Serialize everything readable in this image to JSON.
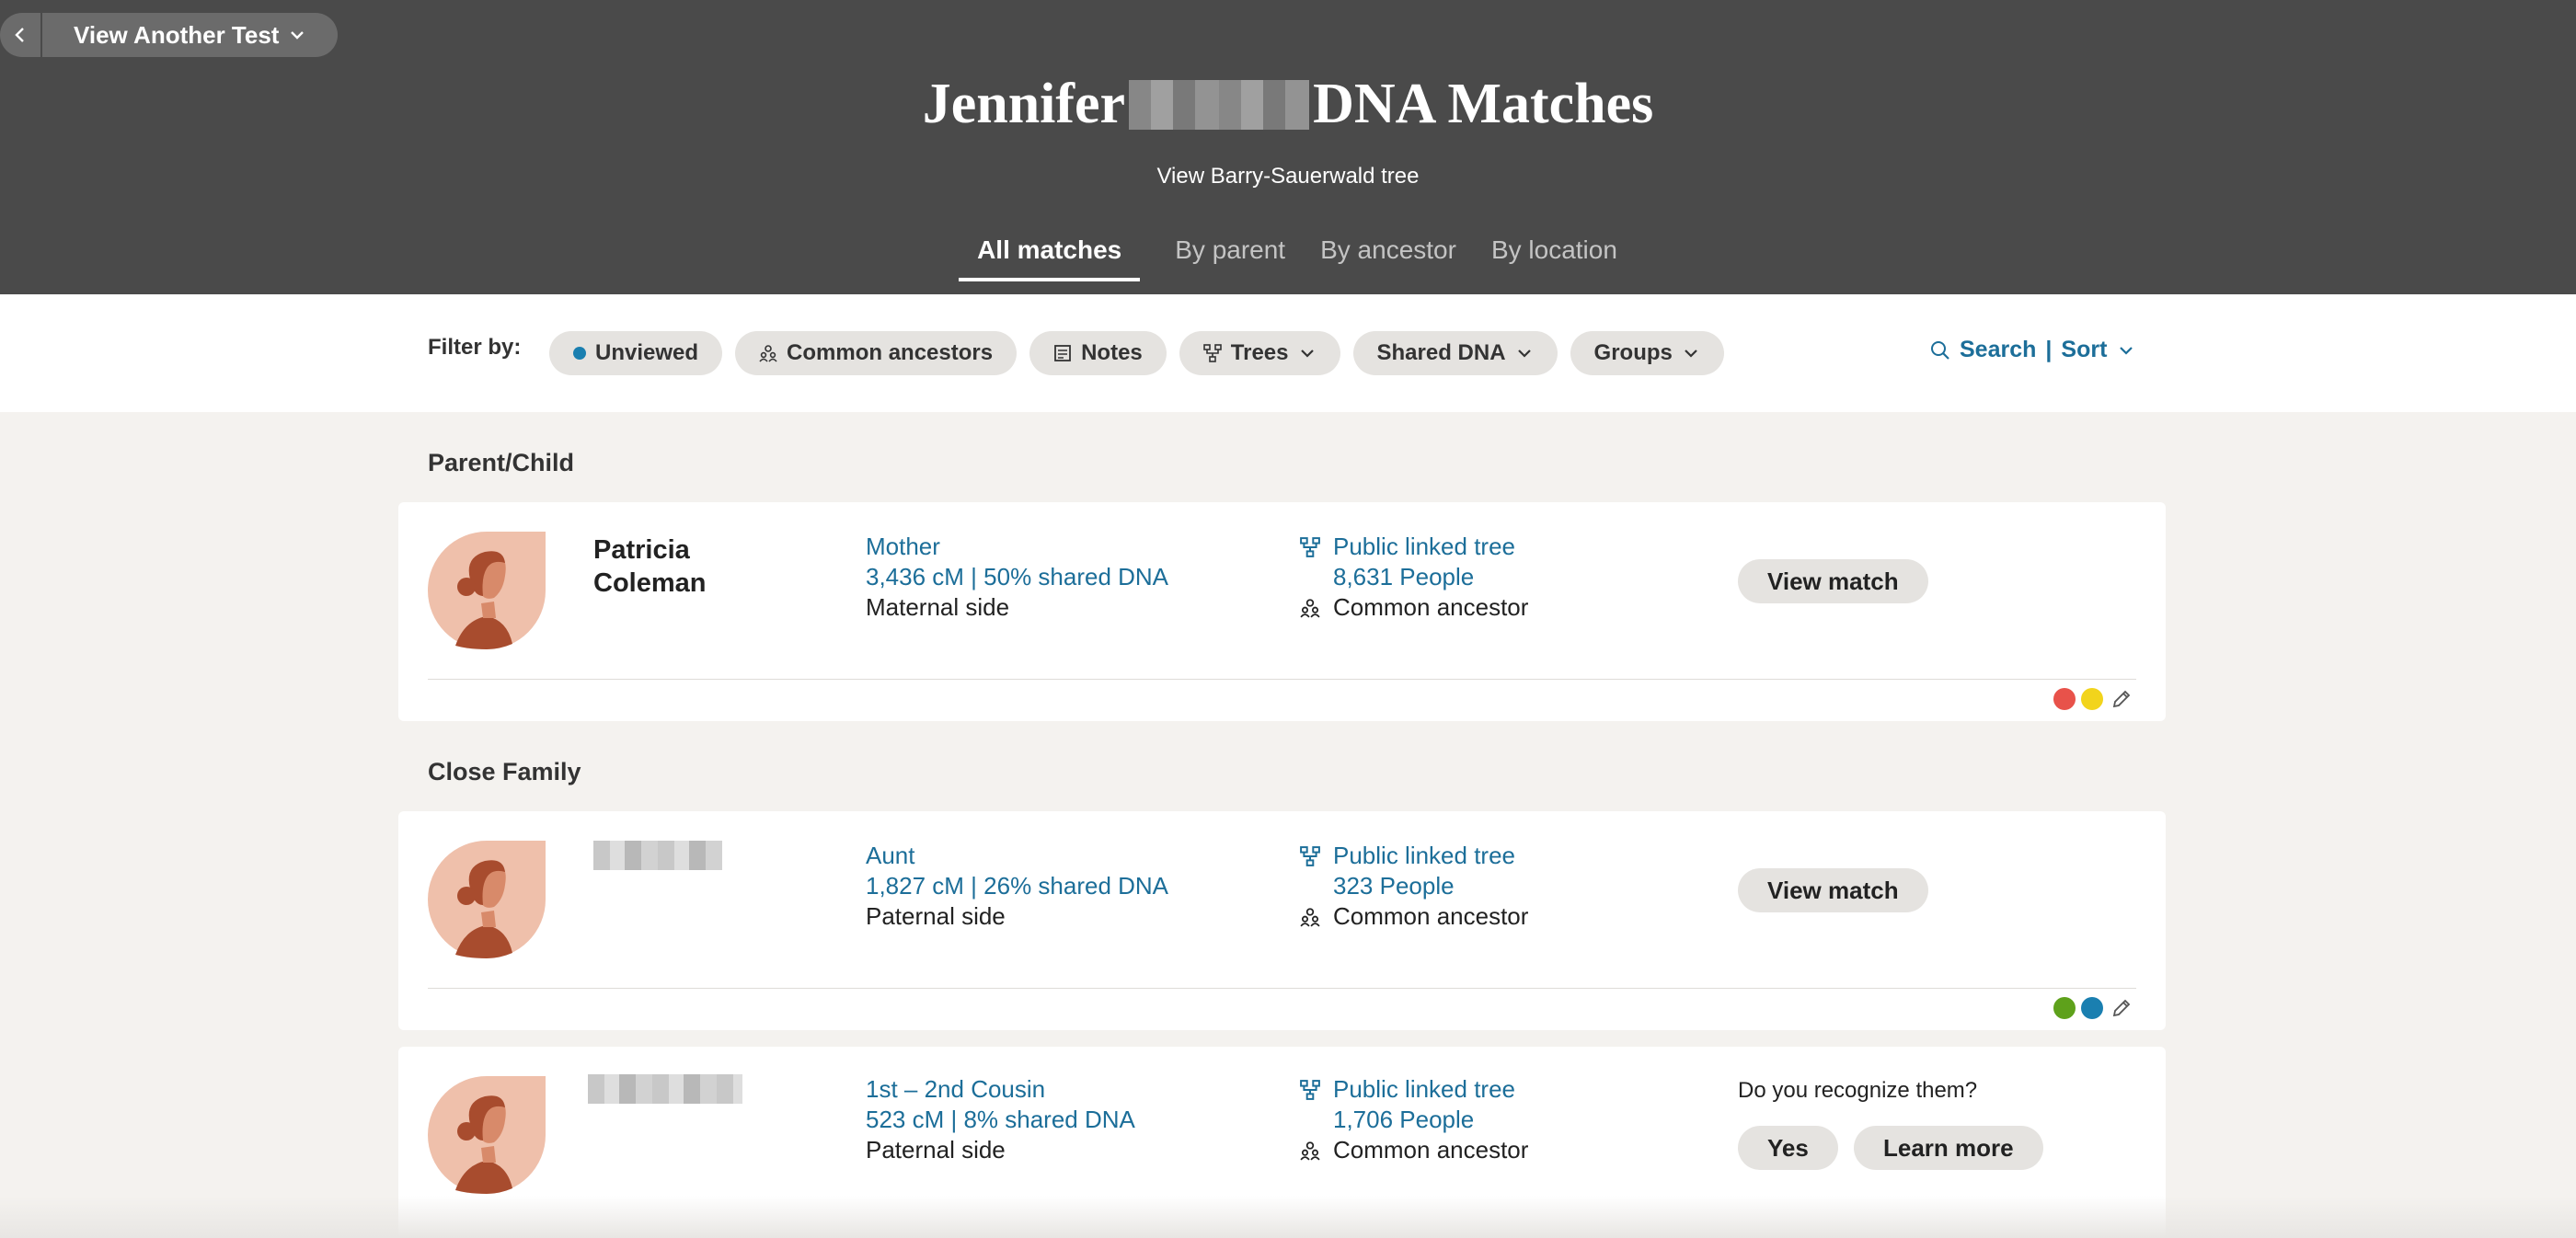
{
  "header": {
    "view_another_test": "View Another Test",
    "title_first": "Jennifer",
    "title_last": "DNA Matches",
    "tree_link": "View Barry-Sauerwald tree",
    "tabs": [
      "All matches",
      "By parent",
      "By ancestor",
      "By location"
    ]
  },
  "filters": {
    "label": "Filter by:",
    "chips": [
      "Unviewed",
      "Common ancestors",
      "Notes",
      "Trees",
      "Shared DNA",
      "Groups"
    ],
    "search": "Search",
    "separator": "|",
    "sort": "Sort"
  },
  "sections": [
    {
      "title": "Parent/Child"
    },
    {
      "title": "Close Family"
    }
  ],
  "matches": [
    {
      "name_line1": "Patricia",
      "name_line2": "Coleman",
      "relationship": "Mother",
      "shared": "3,436 cM | 50% shared DNA",
      "side": "Maternal side",
      "tree_label": "Public linked tree",
      "tree_people": "8,631 People",
      "common_ancestor": "Common ancestor",
      "action": "View match",
      "tag_colors": [
        "#e8524a",
        "#f2d41c"
      ]
    },
    {
      "relationship": "Aunt",
      "shared": "1,827 cM | 26% shared DNA",
      "side": "Paternal side",
      "tree_label": "Public linked tree",
      "tree_people": "323 People",
      "common_ancestor": "Common ancestor",
      "action": "View match",
      "tag_colors": [
        "#5ea11b",
        "#1a7fb0"
      ]
    },
    {
      "relationship": "1st – 2nd Cousin",
      "shared": "523 cM | 8% shared DNA",
      "side": "Paternal side",
      "tree_label": "Public linked tree",
      "tree_people": "1,706 People",
      "common_ancestor": "Common ancestor",
      "prompt": "Do you recognize them?",
      "yes": "Yes",
      "learn_more": "Learn more"
    }
  ],
  "colors": {
    "header_bg": "#4a4a4a",
    "link": "#1c6e99",
    "page_bg": "#f4f2ef"
  }
}
